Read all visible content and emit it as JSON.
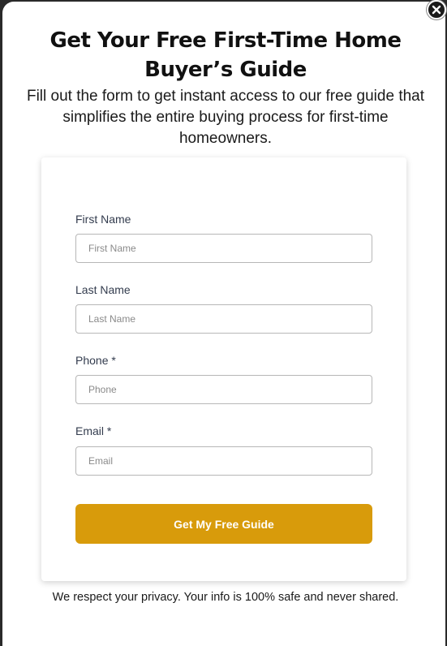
{
  "modal": {
    "title": "Get Your Free First-Time Home Buyer’s Guide",
    "subtitle": "Fill out the form to get instant access to our free guide that simplifies the entire buying process for first-time homeowners.",
    "close_icon": "close-icon"
  },
  "form": {
    "first_name": {
      "label": "First Name",
      "placeholder": "First Name",
      "value": ""
    },
    "last_name": {
      "label": "Last Name",
      "placeholder": "Last Name",
      "value": ""
    },
    "phone": {
      "label": "Phone *",
      "placeholder": "Phone",
      "value": ""
    },
    "email": {
      "label": "Email *",
      "placeholder": "Email",
      "value": ""
    },
    "submit_label": "Get My Free Guide"
  },
  "footer": {
    "privacy_note": "We respect your privacy. Your info is 100% safe and never shared."
  },
  "colors": {
    "accent": "#d89b0b",
    "text": "#111111",
    "label": "#333c4e",
    "input_border": "#b7b7b7"
  }
}
